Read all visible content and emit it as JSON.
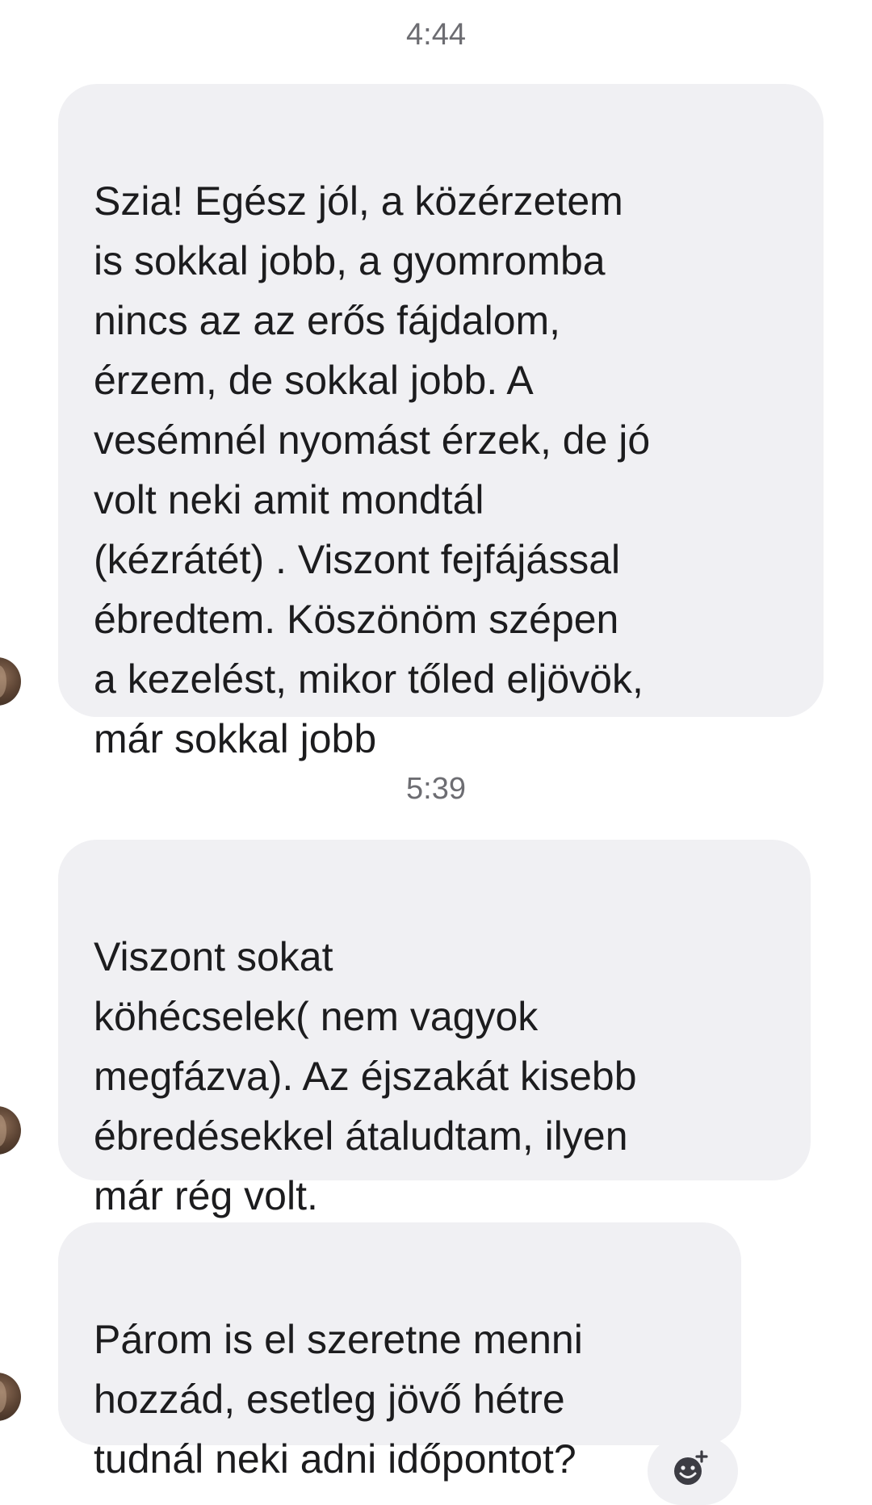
{
  "messages": [
    {
      "time": "4:44",
      "text": "Szia! Egész jól,  a közérzetem\nis sokkal jobb,  a gyomromba\nnincs az az erős fájdalom,\nérzem,  de sokkal jobb. A\nvesémnél nyomást érzek, de jó\nvolt neki amit mondtál\n(kézrátét) . Viszont fejfájással\nébredtem. Köszönöm szépen\na kezelést,  mikor tőled eljövök,\nmár sokkal jobb"
    },
    {
      "time": "5:39",
      "text": "Viszont sokat\nköhécselek( nem vagyok\nmegfázva). Az éjszakát kisebb\nébredésekkel átaludtam,  ilyen\nmár rég volt."
    },
    {
      "text": "Párom is el szeretne menni\nhozzád,  esetleg jövő hétre\ntudnál neki adni időpontot?"
    }
  ],
  "reaction": {
    "icon": "add-reaction-icon"
  }
}
